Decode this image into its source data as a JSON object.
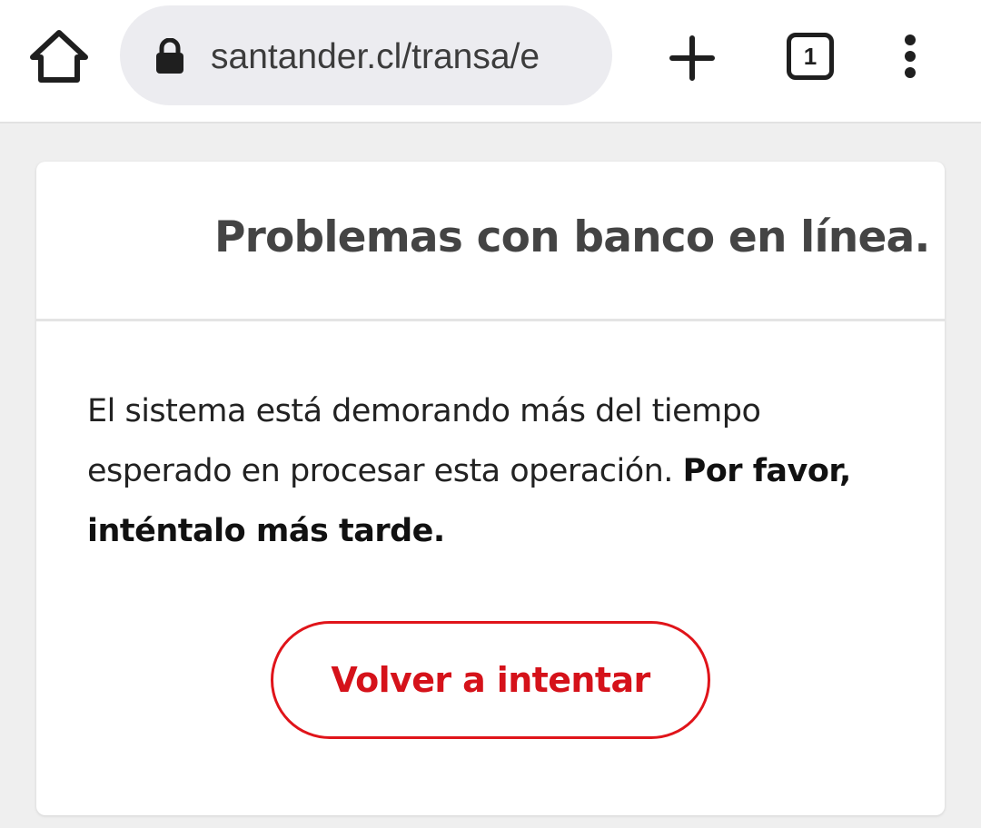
{
  "browser": {
    "url": "santander.cl/transa/e",
    "tab_count": "1",
    "icons": {
      "home": "home-icon",
      "lock": "lock-icon",
      "new_tab": "plus-icon",
      "menu": "more-vert-icon"
    }
  },
  "dialog": {
    "title": "Problemas con banco en línea.",
    "message_normal": "El sistema está demorando más del tiempo esperado en procesar esta operación. ",
    "message_bold": "Por favor, inténtalo más tarde.",
    "retry_button": "Volver a intentar"
  },
  "colors": {
    "accent": "#d5121a",
    "page_background": "#efefef",
    "card_background": "#ffffff"
  }
}
